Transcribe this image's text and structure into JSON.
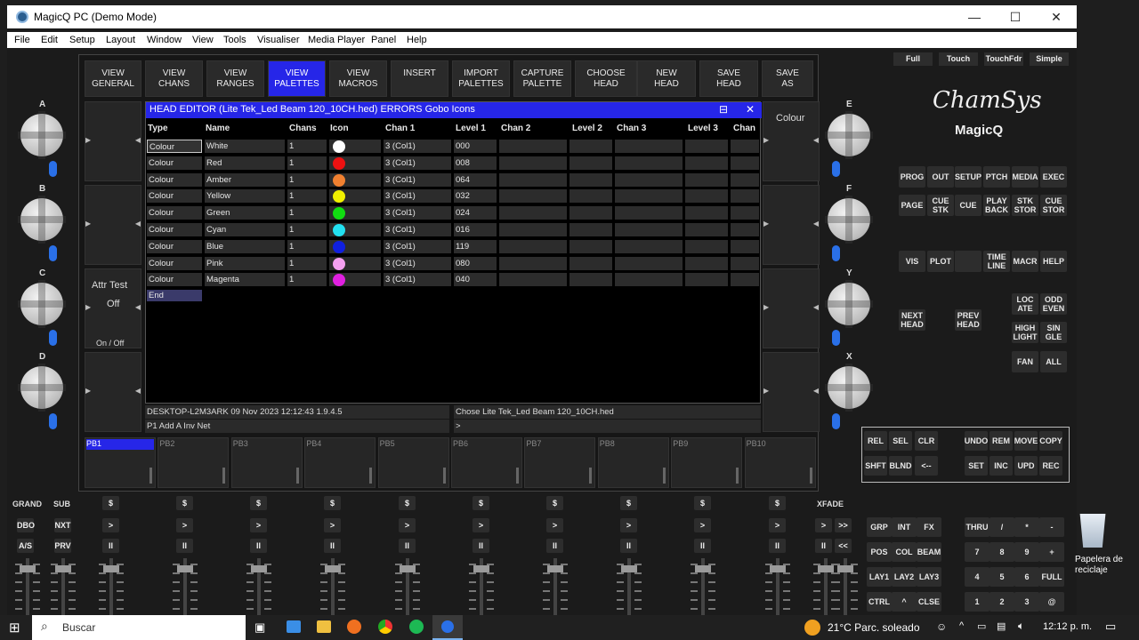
{
  "window": {
    "title": "MagicQ PC (Demo Mode)",
    "minimize": "—",
    "maximize": "☐",
    "close": "✕"
  },
  "menu": [
    "File",
    "Edit",
    "Setup",
    "Layout",
    "Window",
    "View",
    "Tools",
    "Visualiser",
    "Media Player",
    "Panel",
    "Help"
  ],
  "top_buttons": [
    {
      "line1": "VIEW",
      "line2": "GENERAL"
    },
    {
      "line1": "VIEW",
      "line2": "CHANS"
    },
    {
      "line1": "VIEW",
      "line2": "RANGES"
    },
    {
      "line1": "VIEW",
      "line2": "PALETTES"
    },
    {
      "line1": "VIEW",
      "line2": "MACROS"
    },
    {
      "line1": "INSERT",
      "line2": ""
    },
    {
      "line1": "IMPORT",
      "line2": "PALETTES"
    },
    {
      "line1": "CAPTURE",
      "line2": "PALETTE"
    },
    {
      "line1": "CHOOSE",
      "line2": "HEAD"
    },
    {
      "line1": "NEW",
      "line2": "HEAD"
    },
    {
      "line1": "SAVE",
      "line2": "HEAD"
    },
    {
      "line1": "SAVE",
      "line2": "AS"
    }
  ],
  "left_soft": {
    "attr_test": "Attr Test",
    "attr_value": "Off",
    "attr_toggle": "On / Off"
  },
  "right_soft": {
    "colour": "Colour"
  },
  "editor": {
    "title": "HEAD EDITOR (Lite Tek_Led Beam 120_10CH.hed) ERRORS Gobo Icons",
    "headers": [
      "Type",
      "Name",
      "Chans",
      "Icon",
      "Chan 1",
      "Level 1",
      "Chan 2",
      "Level 2",
      "Chan 3",
      "Level 3",
      "Chan"
    ],
    "rows": [
      {
        "type": "Colour",
        "name": "White",
        "chans": "1",
        "color": "#ffffff",
        "chan1": "3 (Col1)",
        "level1": "000"
      },
      {
        "type": "Colour",
        "name": "Red",
        "chans": "1",
        "color": "#ee1111",
        "chan1": "3 (Col1)",
        "level1": "008"
      },
      {
        "type": "Colour",
        "name": "Amber",
        "chans": "1",
        "color": "#f08030",
        "chan1": "3 (Col1)",
        "level1": "064"
      },
      {
        "type": "Colour",
        "name": "Yellow",
        "chans": "1",
        "color": "#f0f000",
        "chan1": "3 (Col1)",
        "level1": "032"
      },
      {
        "type": "Colour",
        "name": "Green",
        "chans": "1",
        "color": "#11dd11",
        "chan1": "3 (Col1)",
        "level1": "024"
      },
      {
        "type": "Colour",
        "name": "Cyan",
        "chans": "1",
        "color": "#22e0f0",
        "chan1": "3 (Col1)",
        "level1": "016"
      },
      {
        "type": "Colour",
        "name": "Blue",
        "chans": "1",
        "color": "#1020e0",
        "chan1": "3 (Col1)",
        "level1": "119"
      },
      {
        "type": "Colour",
        "name": "Pink",
        "chans": "1",
        "color": "#f4a0f0",
        "chan1": "3 (Col1)",
        "level1": "080"
      },
      {
        "type": "Colour",
        "name": "Magenta",
        "chans": "1",
        "color": "#e020e0",
        "chan1": "3 (Col1)",
        "level1": "040"
      }
    ],
    "end_label": "End"
  },
  "status": {
    "left_top": "DESKTOP-L2M3ARK 09 Nov 2023 12:12:43 1.9.4.5",
    "left_bottom": "P1  Add A Inv Net",
    "right_top": "Chose Lite Tek_Led Beam 120_10CH.hed",
    "right_bottom": ">"
  },
  "playbacks": [
    "PB1",
    "PB2",
    "PB3",
    "PB4",
    "PB5",
    "PB6",
    "PB7",
    "PB8",
    "PB9",
    "PB10"
  ],
  "encoders_left": [
    "A",
    "B",
    "C",
    "D"
  ],
  "encoders_right": [
    "E",
    "F",
    "Y",
    "X"
  ],
  "top_right_buttons": [
    "Full",
    "Touch",
    "TouchFdr",
    "Simple"
  ],
  "logo": {
    "brand": "ChamSys",
    "product": "MagicQ"
  },
  "window_buttons_row1": [
    [
      "PROG"
    ],
    [
      "OUT"
    ],
    [
      "SETUP"
    ],
    [
      "PTCH"
    ],
    [
      "MEDIA"
    ],
    [
      "EXEC"
    ]
  ],
  "window_buttons_row2": [
    [
      "PAGE"
    ],
    [
      "CUE",
      "STK"
    ],
    [
      "CUE"
    ],
    [
      "PLAY",
      "BACK"
    ],
    [
      "STK",
      "STOR"
    ],
    [
      "CUE",
      "STOR"
    ]
  ],
  "vis_row": [
    [
      "VIS"
    ],
    [
      "PLOT"
    ],
    [
      ""
    ],
    [
      "TIME",
      "LINE"
    ],
    [
      "MACR"
    ],
    [
      "HELP"
    ]
  ],
  "locate_row": [
    [
      "LOC",
      "ATE"
    ],
    [
      "ODD",
      "EVEN"
    ]
  ],
  "nav_row": [
    [
      "NEXT",
      "HEAD"
    ],
    [
      "PREV",
      "HEAD"
    ],
    [
      "HIGH",
      "LIGHT"
    ],
    [
      "SIN",
      "GLE"
    ]
  ],
  "fan_row": [
    [
      "FAN"
    ],
    [
      "ALL"
    ]
  ],
  "prog_box_row1": [
    "REL",
    "SEL",
    "CLR",
    "UNDO",
    "REM",
    "MOVE",
    "COPY"
  ],
  "prog_box_row2": [
    "SHFT",
    "BLND",
    "<--",
    "SET",
    "INC",
    "UPD",
    "REC"
  ],
  "bottom_left": {
    "grand": "GRAND",
    "sub": "SUB",
    "dbo": "DBO",
    "nxt": "NXT",
    "as": "A/S",
    "prv": "PRV"
  },
  "xfade": "XFADE",
  "fader_symbols": {
    "s": "$",
    "go": ">",
    "pause": "II",
    "ff": ">>",
    "rw": "<<"
  },
  "attr_keys": [
    [
      "GRP",
      "INT",
      "FX"
    ],
    [
      "POS",
      "COL",
      "BEAM"
    ],
    [
      "LAY1",
      "LAY2",
      "LAY3"
    ],
    [
      "CTRL",
      "^",
      "CLSE"
    ]
  ],
  "keypad": [
    [
      "THRU",
      "/",
      "*",
      "-"
    ],
    [
      "7",
      "8",
      "9",
      "+"
    ],
    [
      "4",
      "5",
      "6",
      "FULL"
    ],
    [
      "1",
      "2",
      "3",
      "@"
    ]
  ],
  "desktop": {
    "recycle_line1": "Papelera de",
    "recycle_line2": "reciclaje"
  },
  "taskbar": {
    "search": "Buscar",
    "weather": "21°C  Parc. soleado",
    "time": "12:12 p. m."
  }
}
